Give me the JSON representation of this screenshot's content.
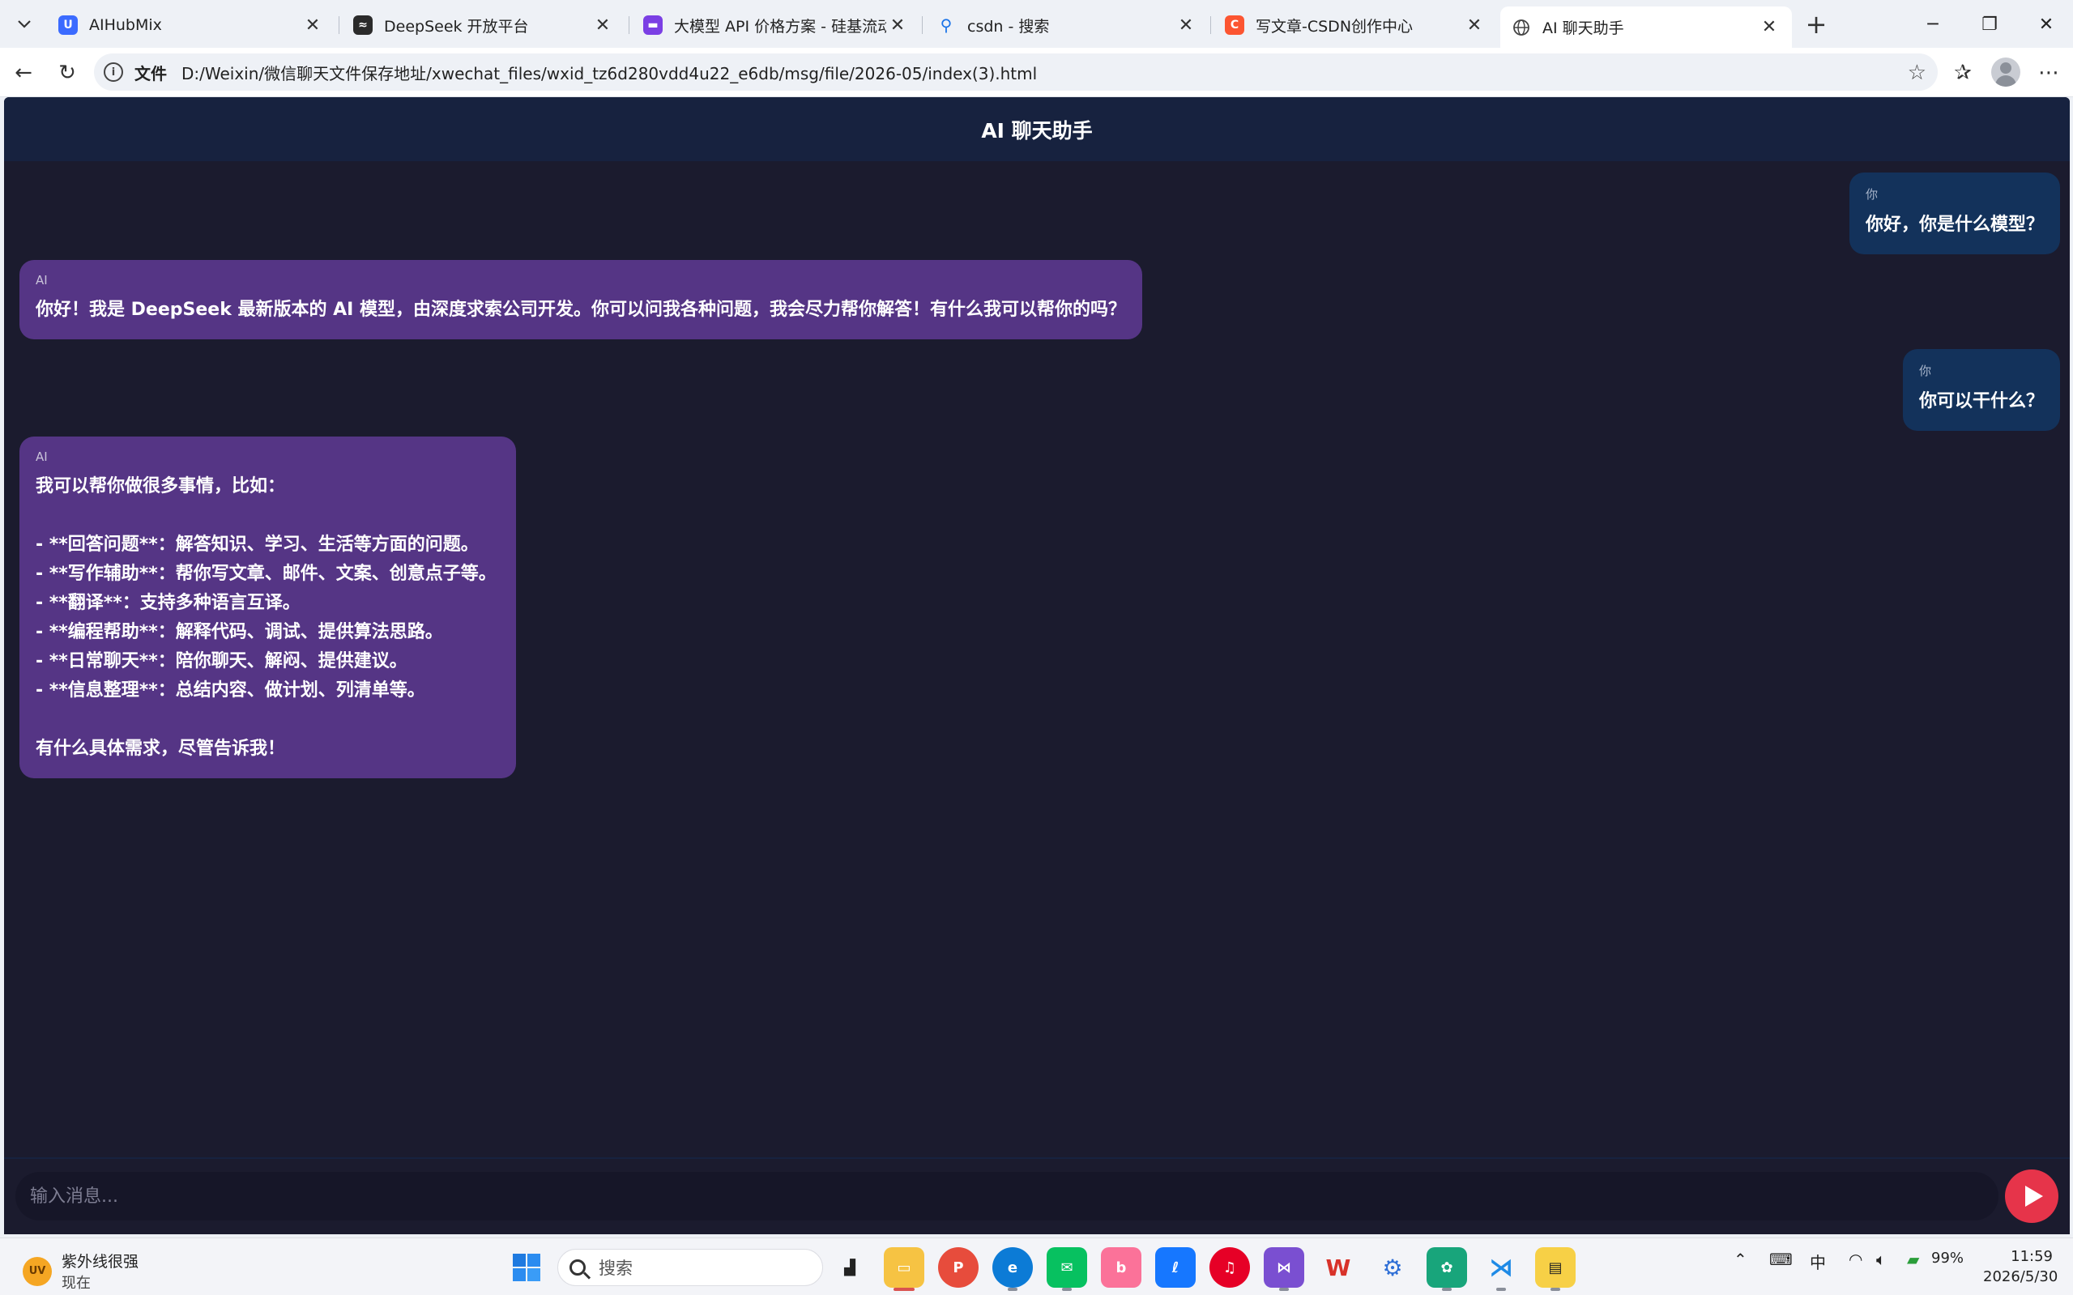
{
  "browser": {
    "tabs": [
      {
        "title": "AIHubMix",
        "icon": "aihubmix-icon",
        "color": "#3b6bff"
      },
      {
        "title": "DeepSeek 开放平台",
        "icon": "deepseek-icon",
        "color": "#2b2b2b"
      },
      {
        "title": "大模型 API 价格方案 - 硅基流动 Si",
        "icon": "siliconflow-icon",
        "color": "#7b3fe4"
      },
      {
        "title": "csdn - 搜索",
        "icon": "search-icon",
        "color": "#1a73e8"
      },
      {
        "title": "写文章-CSDN创作中心",
        "icon": "csdn-icon",
        "color": "#fc5531"
      },
      {
        "title": "AI 聊天助手",
        "icon": "globe-icon",
        "color": "#555555",
        "active": true
      }
    ],
    "address": {
      "scheme_label": "文件",
      "url": "D:/Weixin/微信聊天文件保存地址/xwechat_files/wxid_tz6d280vdd4u22_e6db/msg/file/2026-05/index(3).html"
    }
  },
  "app": {
    "title": "AI 聊天助手",
    "messages": [
      {
        "role": "user",
        "sender": "你",
        "text": "你好，你是什么模型？"
      },
      {
        "role": "ai",
        "sender": "AI",
        "text": "你好！我是 DeepSeek 最新版本的 AI 模型，由深度求索公司开发。你可以问我各种问题，我会尽力帮你解答！有什么我可以帮你的吗？"
      },
      {
        "role": "user",
        "sender": "你",
        "text": "你可以干什么？"
      },
      {
        "role": "ai",
        "sender": "AI",
        "text": "我可以帮你做很多事情，比如：\n\n- **回答问题**：解答知识、学习、生活等方面的问题。\n- **写作辅助**：帮你写文章、邮件、文案、创意点子等。\n- **翻译**：支持多种语言互译。\n- **编程帮助**：解释代码、调试、提供算法思路。\n- **日常聊天**：陪你聊天、解闷、提供建议。\n- **信息整理**：总结内容、做计划、列清单等。\n\n有什么具体需求，尽管告诉我！"
      }
    ],
    "composer": {
      "placeholder": "输入消息..."
    },
    "colors": {
      "header": "#17223f",
      "background": "#1b1b2e",
      "user_bubble": "#13325b",
      "ai_bubble": "#553585",
      "send": "#e6344a"
    }
  },
  "taskbar": {
    "weather": {
      "badge": "UV",
      "line1": "紫外线很强",
      "line2": "现在"
    },
    "search_placeholder": "搜索",
    "tray": {
      "ime": "中",
      "battery": "99%"
    },
    "clock": {
      "time": "11:59",
      "date": "2026/5/30"
    }
  }
}
